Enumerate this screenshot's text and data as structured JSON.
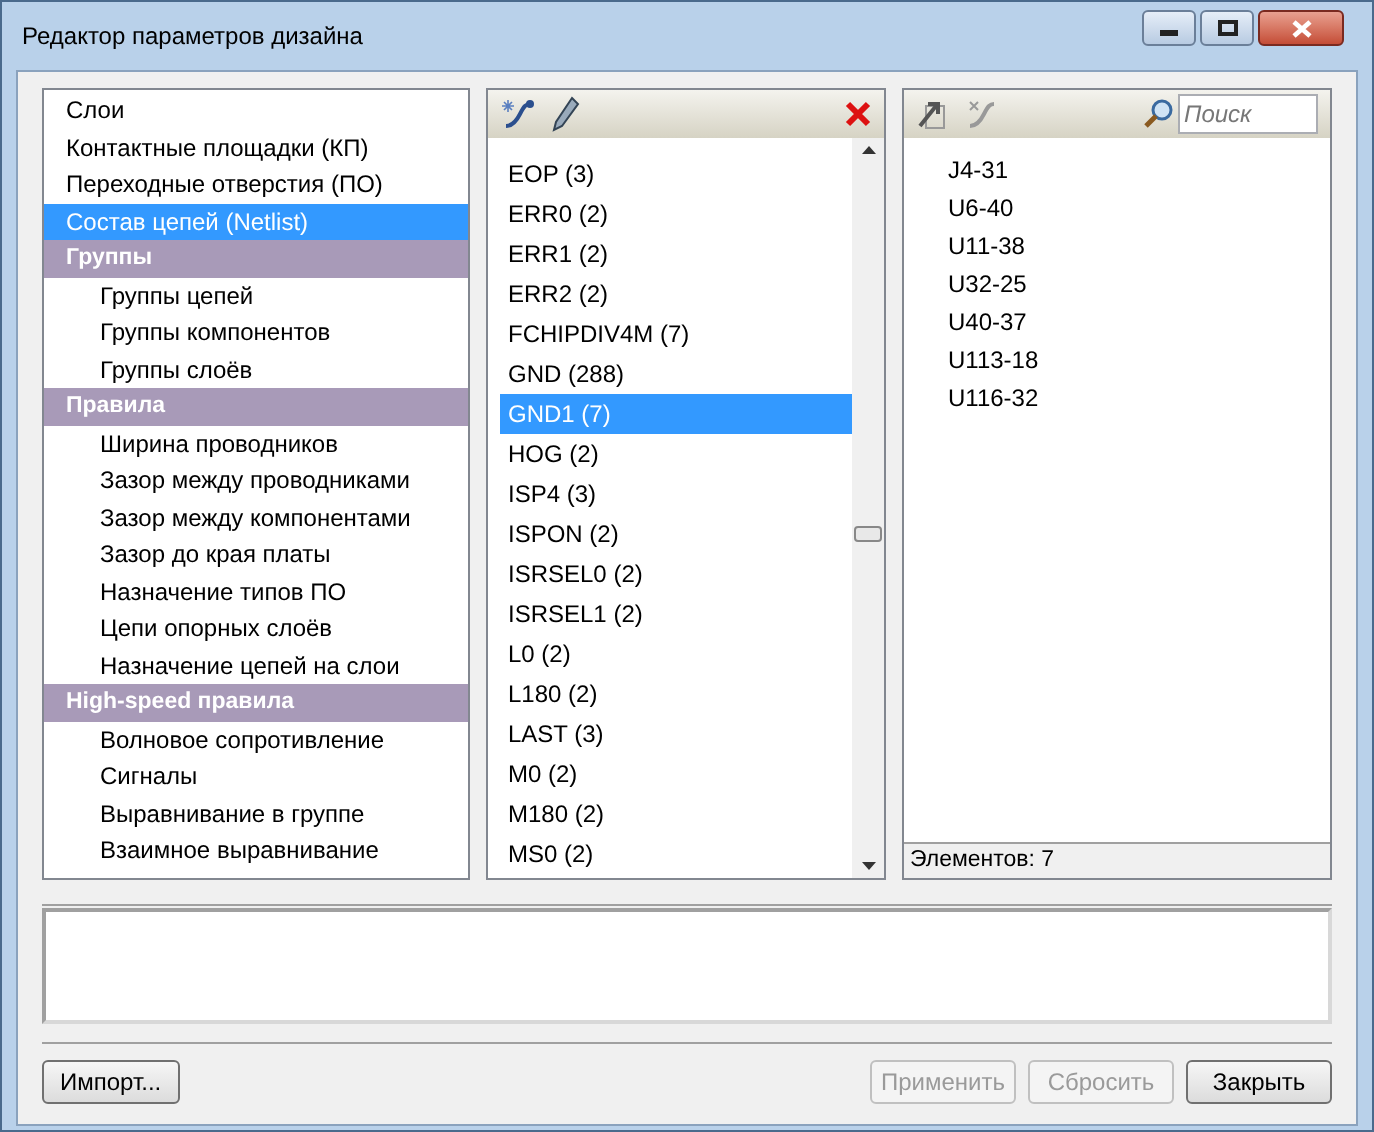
{
  "window": {
    "title": "Редактор параметров дизайна"
  },
  "sidebar": {
    "items": [
      {
        "kind": "item",
        "label": "Слои",
        "selected": false
      },
      {
        "kind": "item",
        "label": "Контактные площадки (КП)",
        "selected": false
      },
      {
        "kind": "item",
        "label": "Переходные отверстия (ПО)",
        "selected": false
      },
      {
        "kind": "item",
        "label": "Состав цепей (Netlist)",
        "selected": true
      },
      {
        "kind": "header",
        "label": "Группы"
      },
      {
        "kind": "sub",
        "label": "Группы цепей",
        "selected": false
      },
      {
        "kind": "sub",
        "label": "Группы компонентов",
        "selected": false
      },
      {
        "kind": "sub",
        "label": "Группы слоёв",
        "selected": false
      },
      {
        "kind": "header",
        "label": "Правила"
      },
      {
        "kind": "sub",
        "label": "Ширина проводников",
        "selected": false
      },
      {
        "kind": "sub",
        "label": "Зазор между проводниками",
        "selected": false
      },
      {
        "kind": "sub",
        "label": "Зазор между компонентами",
        "selected": false
      },
      {
        "kind": "sub",
        "label": "Зазор до края платы",
        "selected": false
      },
      {
        "kind": "sub",
        "label": "Назначение типов ПО",
        "selected": false
      },
      {
        "kind": "sub",
        "label": "Цепи опорных слоёв",
        "selected": false
      },
      {
        "kind": "sub",
        "label": "Назначение цепей на слои",
        "selected": false
      },
      {
        "kind": "header",
        "label": "High-speed правила"
      },
      {
        "kind": "sub",
        "label": "Волновое сопротивление",
        "selected": false
      },
      {
        "kind": "sub",
        "label": "Сигналы",
        "selected": false
      },
      {
        "kind": "sub",
        "label": "Выравнивание в группе",
        "selected": false
      },
      {
        "kind": "sub",
        "label": "Взаимное выравнивание",
        "selected": false
      }
    ]
  },
  "nets": {
    "items": [
      {
        "label": "EOP (3)",
        "selected": false
      },
      {
        "label": "ERR0 (2)",
        "selected": false
      },
      {
        "label": "ERR1 (2)",
        "selected": false
      },
      {
        "label": "ERR2 (2)",
        "selected": false
      },
      {
        "label": "FCHIPDIV4M (7)",
        "selected": false
      },
      {
        "label": "GND (288)",
        "selected": false
      },
      {
        "label": "GND1 (7)",
        "selected": true
      },
      {
        "label": "HOG (2)",
        "selected": false
      },
      {
        "label": "ISP4 (3)",
        "selected": false
      },
      {
        "label": "ISPON (2)",
        "selected": false
      },
      {
        "label": "ISRSEL0 (2)",
        "selected": false
      },
      {
        "label": "ISRSEL1 (2)",
        "selected": false
      },
      {
        "label": "L0 (2)",
        "selected": false
      },
      {
        "label": "L180 (2)",
        "selected": false
      },
      {
        "label": "LAST (3)",
        "selected": false
      },
      {
        "label": "M0 (2)",
        "selected": false
      },
      {
        "label": "M180 (2)",
        "selected": false
      },
      {
        "label": "MS0 (2)",
        "selected": false
      }
    ]
  },
  "pins": {
    "search": {
      "placeholder": "Поиск"
    },
    "items": [
      "J4-31",
      "U6-40",
      "U11-38",
      "U32-25",
      "U40-37",
      "U113-18",
      "U116-32"
    ],
    "status": "Элементов: 7"
  },
  "buttons": [
    {
      "label": "Импорт...",
      "disabled": false
    },
    {
      "label": "Применить",
      "disabled": true
    },
    {
      "label": "Сбросить",
      "disabled": true
    },
    {
      "label": "Закрыть",
      "disabled": false
    }
  ]
}
